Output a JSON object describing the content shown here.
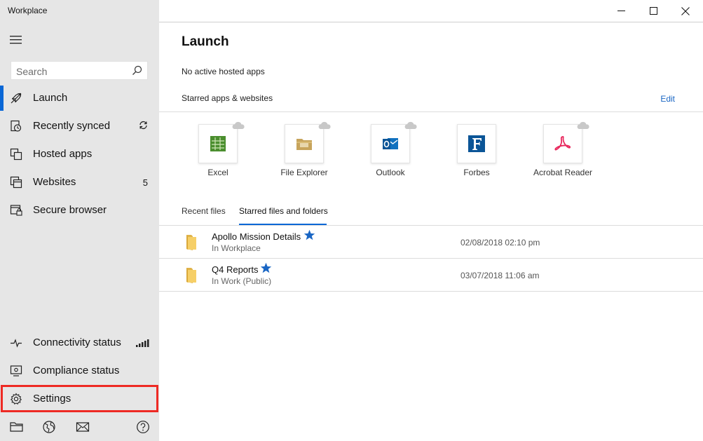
{
  "window": {
    "title": "Workplace"
  },
  "sidebar": {
    "search_placeholder": "Search",
    "items": [
      {
        "label": "Launch",
        "icon": "rocket-icon",
        "active": true
      },
      {
        "label": "Recently synced",
        "icon": "sync-clock-icon",
        "trail_icon": "refresh-icon"
      },
      {
        "label": "Hosted apps",
        "icon": "hosted-apps-icon"
      },
      {
        "label": "Websites",
        "icon": "websites-icon",
        "count": "5"
      },
      {
        "label": "Secure browser",
        "icon": "secure-browser-icon"
      }
    ],
    "bottom_items": [
      {
        "label": "Connectivity status",
        "icon": "pulse-icon",
        "trail_icon": "signal-bars-icon"
      },
      {
        "label": "Compliance status",
        "icon": "compliance-monitor-icon"
      },
      {
        "label": "Settings",
        "icon": "gear-icon",
        "highlighted": true
      }
    ],
    "footer_icons": [
      "folder-icon",
      "globe-icon",
      "mail-icon",
      "help-icon"
    ]
  },
  "main": {
    "title": "Launch",
    "no_hosted_apps": "No active hosted apps",
    "starred_label": "Starred apps & websites",
    "edit_label": "Edit",
    "apps": [
      {
        "name": "Excel",
        "icon": "excel-icon",
        "color": "#4a8e2e"
      },
      {
        "name": "File Explorer",
        "icon": "file-explorer-icon",
        "color": "#c7a45c"
      },
      {
        "name": "Outlook",
        "icon": "outlook-icon",
        "color": "#1071bf"
      },
      {
        "name": "Forbes",
        "icon": "forbes-icon",
        "color": "#0b5597"
      },
      {
        "name": "Acrobat Reader",
        "icon": "acrobat-reader-icon",
        "color": "#e8275c"
      }
    ],
    "tabs": [
      {
        "label": "Recent files",
        "active": false
      },
      {
        "label": "Starred files and folders",
        "active": true
      }
    ],
    "files": [
      {
        "name": "Apollo Mission Details",
        "location": "In Workplace",
        "date": "02/08/2018 02:10 pm"
      },
      {
        "name": "Q4 Reports",
        "location": "In Work (Public)",
        "date": "03/07/2018 11:06 am"
      }
    ]
  },
  "colors": {
    "accent": "#0a67d6",
    "highlight_border": "#ee2a24",
    "sidebar_bg": "#e6e6e6",
    "star": "#1a66c4"
  }
}
